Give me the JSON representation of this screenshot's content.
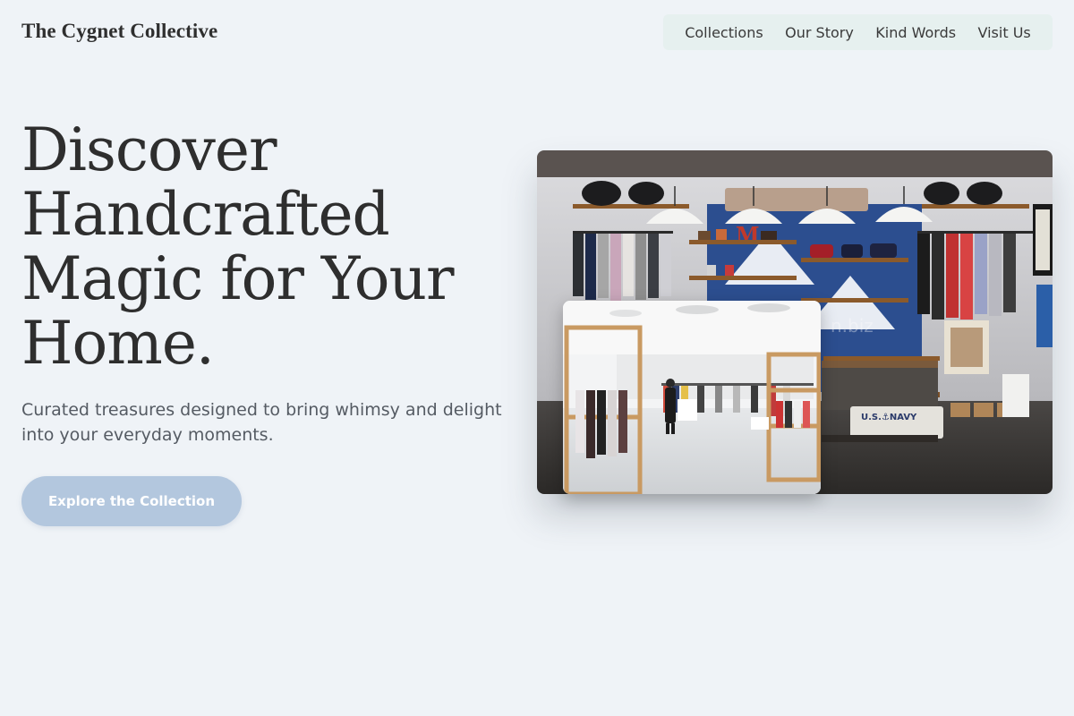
{
  "header": {
    "brand": "The Cygnet Collective",
    "nav": [
      {
        "label": "Collections"
      },
      {
        "label": "Our Story"
      },
      {
        "label": "Kind Words"
      },
      {
        "label": "Visit Us"
      }
    ]
  },
  "hero": {
    "title_lines": [
      "Discover",
      "Handcrafted",
      "Magic for Your",
      "Home."
    ],
    "subtitle": "Curated treasures designed to bring whimsy and delight into your everyday moments.",
    "cta_label": "Explore the Collection"
  },
  "images": {
    "main_label": "M",
    "main_sign": "U.S.⚓NAVY",
    "watermark": "n.biz"
  },
  "colors": {
    "background": "#eff3f7",
    "nav_background": "#e6f0ef",
    "cta": "#b3c7de",
    "text": "#2e2e2e"
  }
}
